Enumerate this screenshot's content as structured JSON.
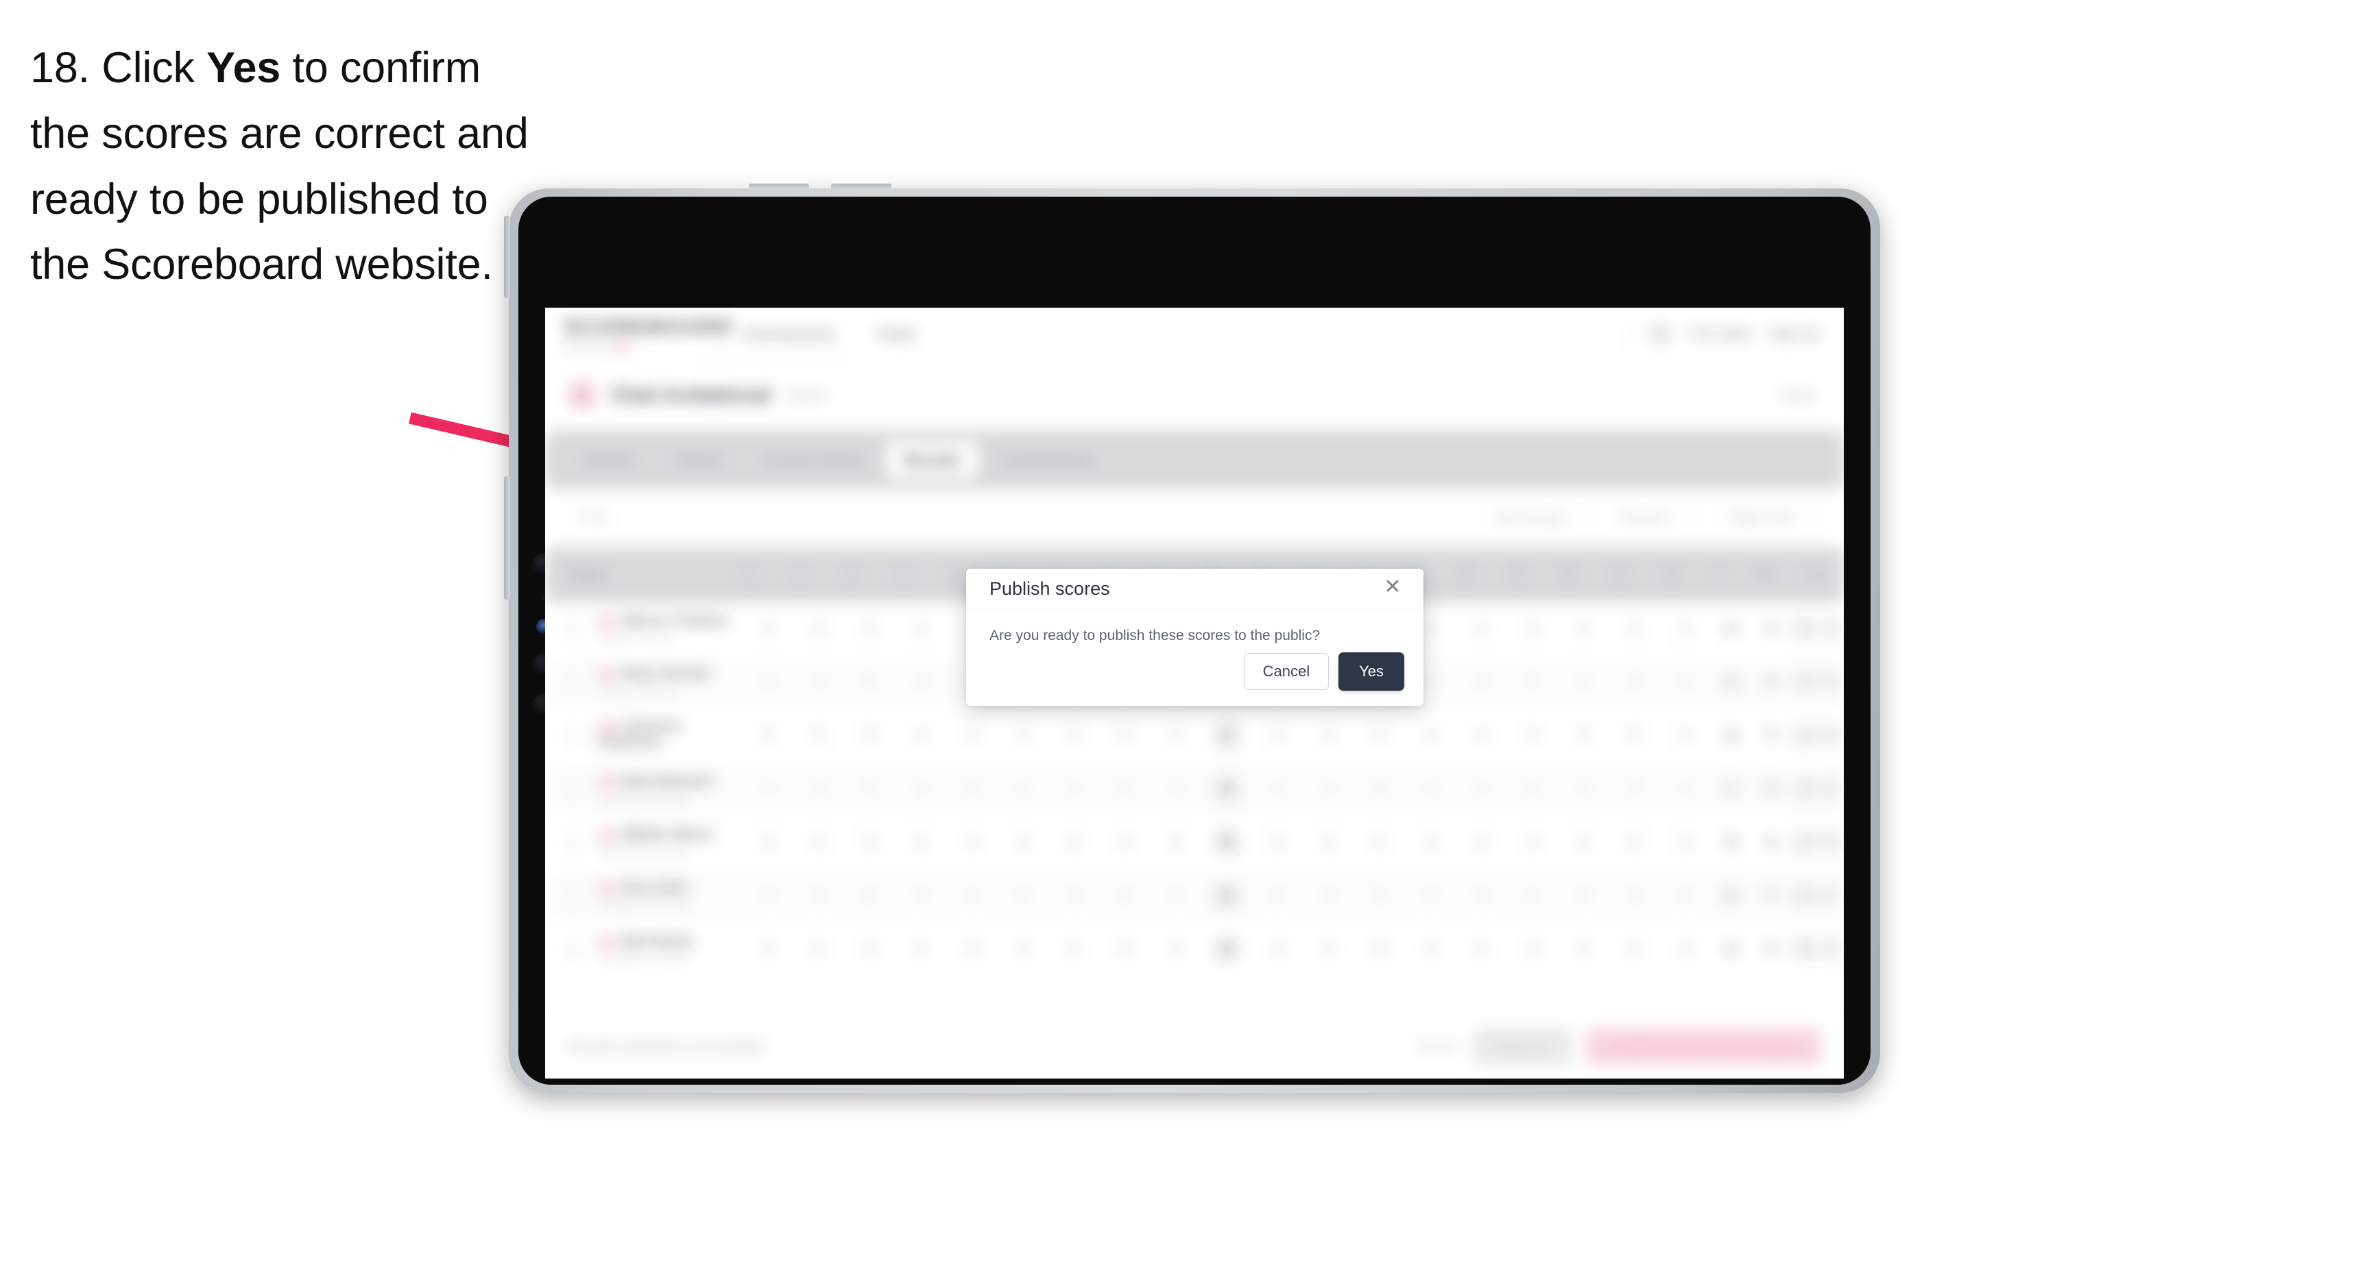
{
  "caption": {
    "step_number": "18.",
    "text_before": "Click ",
    "bold_word": "Yes",
    "text_after": " to confirm the scores are correct and ready to be published to the Scoreboard website."
  },
  "annotation": {
    "arrow_color": "#ed2a5f",
    "arrow_name": "pointer-arrow"
  },
  "device": {
    "type": "tablet",
    "orientation": "landscape",
    "bezel_color": "#0b0b0c",
    "frame_color": "#cfd2d5"
  },
  "app": {
    "header": {
      "logo": "SCOREBOARD",
      "logo_sub_prefix": "Powered by ",
      "logo_sub_brand": "Golf",
      "nav_links": [
        "Tournaments",
        "Feed"
      ],
      "user_name": "Tim Oates",
      "sign_out": "Sign out",
      "avatar_icon": "user-avatar-icon"
    },
    "tournament": {
      "icon": "tournament-badge-icon",
      "name": "Club Invitational",
      "sub": "2024",
      "right_label": "Save"
    },
    "tabs": [
      {
        "label": "Details",
        "active": false
      },
      {
        "label": "Teams",
        "active": false
      },
      {
        "label": "Course Setup",
        "active": false
      },
      {
        "label": "Results",
        "active": true
      },
      {
        "label": "Leaderboard",
        "active": false
      }
    ],
    "filters": {
      "search_placeholder": "Find",
      "selects": [
        "Tee Groups",
        "Round 1",
        "Table Only"
      ],
      "chevron_icon": "chevron-down-icon"
    },
    "table": {
      "first_column": "Player",
      "hole_headers": [
        {
          "num": "1",
          "par": "Par 4"
        },
        {
          "num": "2",
          "par": "Par 3"
        },
        {
          "num": "3",
          "par": "Par 5"
        },
        {
          "num": "4",
          "par": "Par 4"
        },
        {
          "num": "5",
          "par": "Par 4"
        },
        {
          "num": "6",
          "par": "Par 3"
        },
        {
          "num": "7",
          "par": "Par 4"
        },
        {
          "num": "8",
          "par": "Par 5"
        },
        {
          "num": "9",
          "par": "Par 4"
        },
        {
          "num": "Out",
          "par": "36"
        },
        {
          "num": "10",
          "par": "Par 4"
        },
        {
          "num": "11",
          "par": "Par 3"
        },
        {
          "num": "12",
          "par": "Par 5"
        },
        {
          "num": "13",
          "par": "Par 4"
        },
        {
          "num": "14",
          "par": "Par 4"
        },
        {
          "num": "15",
          "par": "Par 3"
        },
        {
          "num": "16",
          "par": "Par 4"
        },
        {
          "num": "17",
          "par": "Par 5"
        },
        {
          "num": "18",
          "par": "Par 4"
        }
      ],
      "tail_headers": [
        "In",
        "Total",
        "Score"
      ],
      "rows": [
        {
          "checkbox_icon": "row-checkbox",
          "flag_icon": "player-flag-icon",
          "name": "Warren Tomkins",
          "club": "Clayton Champ",
          "holes": [
            "4",
            "4",
            "5",
            "4",
            "4",
            "3",
            "4",
            "5",
            "4",
            "37",
            "4",
            "3",
            "5",
            "4",
            "4",
            "3",
            "4",
            "5",
            "4"
          ],
          "in": "36",
          "total": "73",
          "score": [
            "+01",
            "73"
          ]
        },
        {
          "checkbox_icon": "row-checkbox",
          "flag_icon": "player-flag-icon",
          "name": "Peter Pannell",
          "club": "Clayton Champ",
          "holes": [
            "4",
            "4",
            "5",
            "4",
            "4",
            "3",
            "4",
            "5",
            "4",
            "37",
            "4",
            "3",
            "5",
            "4",
            "4",
            "3",
            "4",
            "5",
            "4"
          ],
          "in": "36",
          "total": "74",
          "score": [
            "+02",
            "74"
          ]
        },
        {
          "checkbox_icon": "row-checkbox",
          "flag_icon": "player-flag-icon",
          "name": "Cameron Robinson",
          "club": "",
          "holes": [
            "4",
            "5",
            "5",
            "4",
            "4",
            "3",
            "4",
            "5",
            "4",
            "38",
            "4",
            "3",
            "5",
            "4",
            "4",
            "3",
            "4",
            "5",
            "4"
          ],
          "in": "36",
          "total": "75",
          "score": [
            "+03",
            "75"
          ]
        },
        {
          "checkbox_icon": "row-checkbox",
          "flag_icon": "player-flag-icon",
          "name": "Dale Bateman",
          "club": "Sandbank Country",
          "holes": [
            "4",
            "4",
            "5",
            "4",
            "5",
            "3",
            "4",
            "5",
            "4",
            "38",
            "4",
            "3",
            "5",
            "4",
            "4",
            "3",
            "4",
            "5",
            "4"
          ],
          "in": "37",
          "total": "76",
          "score": [
            "+04",
            "76"
          ]
        },
        {
          "checkbox_icon": "row-checkbox",
          "flag_icon": "player-flag-icon",
          "name": "William Mears",
          "club": "Sandbank Country",
          "holes": [
            "4",
            "4",
            "5",
            "4",
            "4",
            "3",
            "4",
            "5",
            "4",
            "38",
            "4",
            "3",
            "5",
            "4",
            "4",
            "3",
            "4",
            "5",
            "4"
          ],
          "in": "38",
          "total": "76",
          "score": [
            "+04",
            "76"
          ]
        },
        {
          "checkbox_icon": "row-checkbox",
          "flag_icon": "player-flag-icon",
          "name": "Ross Britt",
          "club": "Sandbank Country",
          "holes": [
            "4",
            "4",
            "5",
            "4",
            "4",
            "3",
            "4",
            "5",
            "4",
            "38",
            "4",
            "3",
            "5",
            "4",
            "4",
            "3",
            "4",
            "5",
            "4"
          ],
          "in": "38",
          "total": "77",
          "score": [
            "+05",
            "77"
          ]
        },
        {
          "checkbox_icon": "row-checkbox",
          "flag_icon": "player-flag-icon",
          "name": "Bob Bailey",
          "club": "Sandbank Country",
          "holes": [
            "4",
            "4",
            "5",
            "4",
            "4",
            "3",
            "4",
            "5",
            "4",
            "38",
            "4",
            "3",
            "5",
            "4",
            "4",
            "3",
            "4",
            "5",
            "4"
          ],
          "in": "38",
          "total": "78",
          "score": [
            "+06",
            "78"
          ]
        }
      ]
    },
    "bottom_bar": {
      "status": "Results published successfully",
      "link": "Cancel",
      "grey_button": "Save all",
      "pink_button": "Publish scores to Scoreboard"
    }
  },
  "modal": {
    "title": "Publish scores",
    "body": "Are you ready to publish these scores to the public?",
    "close_icon": "close-icon",
    "close_glyph": "✕",
    "cancel_label": "Cancel",
    "yes_label": "Yes",
    "yes_bg": "#2d3748"
  }
}
